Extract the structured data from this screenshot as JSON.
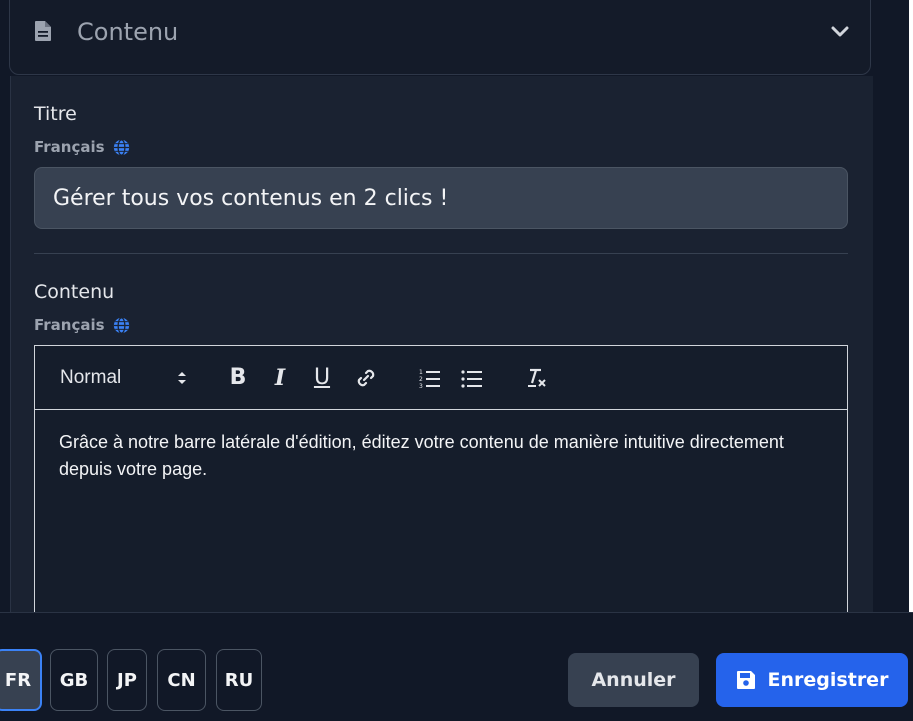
{
  "section": {
    "title": "Contenu"
  },
  "title_field": {
    "label": "Titre",
    "language": "Français",
    "value": "Gérer tous vos contenus en 2 clics !"
  },
  "content_field": {
    "label": "Contenu",
    "language": "Français",
    "toolbar": {
      "format_select": "Normal",
      "bold": "B",
      "italic": "I",
      "underline": "U"
    },
    "text": "Grâce à notre barre latérale d'édition, éditez votre contenu de manière intuitive directement depuis votre page."
  },
  "languages": [
    {
      "code": "FR",
      "active": true
    },
    {
      "code": "GB",
      "active": false
    },
    {
      "code": "JP",
      "active": false
    },
    {
      "code": "CN",
      "active": false
    },
    {
      "code": "RU",
      "active": false
    }
  ],
  "actions": {
    "cancel": "Annuler",
    "save": "Enregistrer"
  },
  "colors": {
    "accent": "#2563eb",
    "background": "#111827",
    "panel": "#1a2231"
  },
  "icons": {
    "section": "document-icon",
    "collapse": "chevron-down-icon",
    "language": "globe-icon",
    "save": "floppy-disk-icon"
  }
}
